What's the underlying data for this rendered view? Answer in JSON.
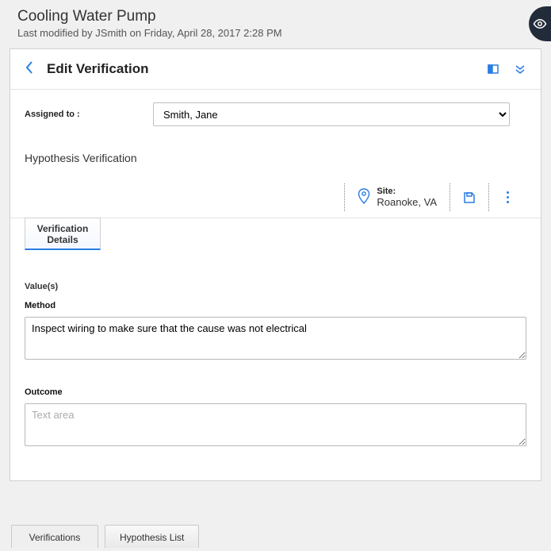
{
  "header": {
    "title": "Cooling Water Pump",
    "modified": "Last modified by JSmith on Friday, April 28, 2017 2:28 PM"
  },
  "card": {
    "title": "Edit Verification"
  },
  "assigned": {
    "label": "Assigned to :",
    "value": "Smith, Jane"
  },
  "section": {
    "title": "Hypothesis Verification"
  },
  "meta": {
    "site_label": "Site:",
    "site_value": "Roanoke, VA"
  },
  "subtab": {
    "line1": "Verification",
    "line2": "Details"
  },
  "form": {
    "values_label": "Value(s)",
    "method_label": "Method",
    "method_value": "Inspect wiring to make sure that the cause was not electrical",
    "outcome_label": "Outcome",
    "outcome_placeholder": "Text area",
    "outcome_value": ""
  },
  "footer": {
    "verifications": "Verifications",
    "hypothesis": "Hypothesis List"
  }
}
